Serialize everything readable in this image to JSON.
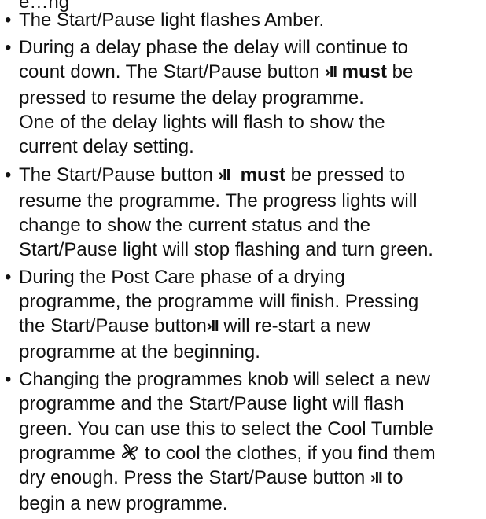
{
  "icons": {
    "start_pause": "start-pause-symbol",
    "fan": "cool-tumble-fan-icon"
  },
  "colors": {
    "text": "#111111",
    "background": "#ffffff"
  },
  "symbols": {
    "start_pause": "›II"
  },
  "top_fragment": "e…ng",
  "bullets": [
    {
      "lines": [
        "The Start/Pause light flashes Amber."
      ]
    },
    {
      "l1": "During a delay phase the delay will continue to",
      "l2_pre": "count down. The Start/Pause button ",
      "l2_bold": "must",
      "l2_post": " be",
      "l3": "pressed to resume the delay programme.",
      "l4": "One of the delay lights will flash to show the",
      "l5": "current delay setting."
    },
    {
      "l1_pre": "The Start/Pause button ",
      "l1_bold": "must",
      "l1_post": " be pressed to",
      "l2": "resume the programme. The progress lights will",
      "l3": "change to show the current status and the",
      "l4": "Start/Pause light will stop flashing and turn green."
    },
    {
      "l1": "During the Post Care phase of a drying",
      "l2": "programme, the programme will finish. Pressing",
      "l3_pre": "the Start/Pause button",
      "l3_post": " will re-start a new",
      "l4": "programme at the beginning."
    },
    {
      "l1": "Changing the programmes knob will select a new",
      "l2": "programme and the Start/Pause light will flash",
      "l3": "green. You can use this to select the Cool Tumble",
      "l4_pre": "programme ",
      "l4_post": " to cool the clothes, if you find them",
      "l5_pre": "dry enough. Press the Start/Pause button ",
      "l5_post": " to",
      "l6": "begin a new programme."
    }
  ]
}
